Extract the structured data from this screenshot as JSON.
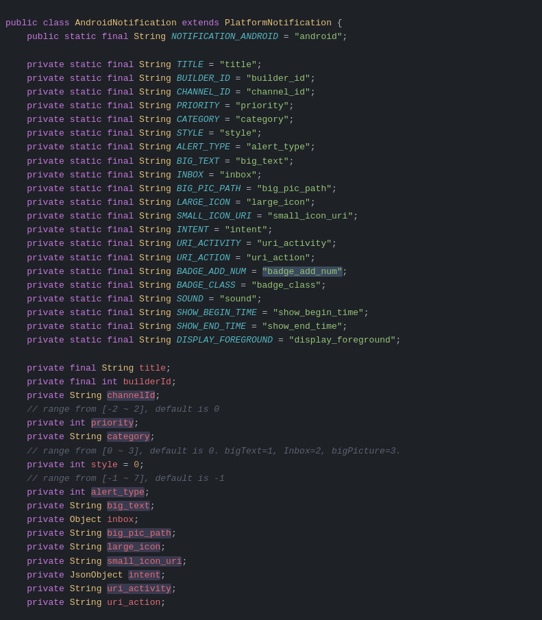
{
  "code": {
    "lines": [
      {
        "id": 1,
        "html": "<span class='kw'>public</span> <span class='kw'>class</span> <span class='cls'>AndroidNotification</span> <span class='kw'>extends</span> <span class='cls'>PlatformNotification</span> <span class='plain'>{</span>"
      },
      {
        "id": 2,
        "html": "    <span class='kw'>public</span> <span class='kw'>static</span> <span class='kw'>final</span> <span class='type'>String</span> <span class='const'>NOTIFICATION_ANDROID</span> <span class='plain'>= </span><span class='str'>\"android\"</span><span class='plain'>;</span>"
      },
      {
        "id": 3,
        "html": ""
      },
      {
        "id": 4,
        "html": "    <span class='kw'>private</span> <span class='kw'>static</span> <span class='kw'>final</span> <span class='type'>String</span> <span class='const'>TITLE</span> <span class='plain'>= </span><span class='str'>\"title\"</span><span class='plain'>;</span>"
      },
      {
        "id": 5,
        "html": "    <span class='kw'>private</span> <span class='kw'>static</span> <span class='kw'>final</span> <span class='type'>String</span> <span class='const'>BUILDER_ID</span> <span class='plain'>= </span><span class='str'>\"builder_id\"</span><span class='plain'>;</span>"
      },
      {
        "id": 6,
        "html": "    <span class='kw'>private</span> <span class='kw'>static</span> <span class='kw'>final</span> <span class='type'>String</span> <span class='const'>CHANNEL_ID</span> <span class='plain'>= </span><span class='str'>\"channel_id\"</span><span class='plain'>;</span>"
      },
      {
        "id": 7,
        "html": "    <span class='kw'>private</span> <span class='kw'>static</span> <span class='kw'>final</span> <span class='type'>String</span> <span class='const'>PRIORITY</span> <span class='plain'>= </span><span class='str'>\"priority\"</span><span class='plain'>;</span>"
      },
      {
        "id": 8,
        "html": "    <span class='kw'>private</span> <span class='kw'>static</span> <span class='kw'>final</span> <span class='type'>String</span> <span class='const'>CATEGORY</span> <span class='plain'>= </span><span class='str'>\"category\"</span><span class='plain'>;</span>"
      },
      {
        "id": 9,
        "html": "    <span class='kw'>private</span> <span class='kw'>static</span> <span class='kw'>final</span> <span class='type'>String</span> <span class='const'>STYLE</span> <span class='plain'>= </span><span class='str'>\"style\"</span><span class='plain'>;</span>"
      },
      {
        "id": 10,
        "html": "    <span class='kw'>private</span> <span class='kw'>static</span> <span class='kw'>final</span> <span class='type'>String</span> <span class='const'>ALERT_TYPE</span> <span class='plain'>= </span><span class='str'>\"alert_type\"</span><span class='plain'>;</span>"
      },
      {
        "id": 11,
        "html": "    <span class='kw'>private</span> <span class='kw'>static</span> <span class='kw'>final</span> <span class='type'>String</span> <span class='const'>BIG_TEXT</span> <span class='plain'>= </span><span class='str'>\"big_text\"</span><span class='plain'>;</span>"
      },
      {
        "id": 12,
        "html": "    <span class='kw'>private</span> <span class='kw'>static</span> <span class='kw'>final</span> <span class='type'>String</span> <span class='const'>INBOX</span> <span class='plain'>= </span><span class='str'>\"inbox\"</span><span class='plain'>;</span>"
      },
      {
        "id": 13,
        "html": "    <span class='kw'>private</span> <span class='kw'>static</span> <span class='kw'>final</span> <span class='type'>String</span> <span class='const'>BIG_PIC_PATH</span> <span class='plain'>= </span><span class='str'>\"big_pic_path\"</span><span class='plain'>;</span>"
      },
      {
        "id": 14,
        "html": "    <span class='kw'>private</span> <span class='kw'>static</span> <span class='kw'>final</span> <span class='type'>String</span> <span class='const'>LARGE_ICON</span> <span class='plain'>= </span><span class='str'>\"large_icon\"</span><span class='plain'>;</span>"
      },
      {
        "id": 15,
        "html": "    <span class='kw'>private</span> <span class='kw'>static</span> <span class='kw'>final</span> <span class='type'>String</span> <span class='const'>SMALL_ICON_URI</span> <span class='plain'>= </span><span class='str'>\"small_icon_uri\"</span><span class='plain'>;</span>"
      },
      {
        "id": 16,
        "html": "    <span class='kw'>private</span> <span class='kw'>static</span> <span class='kw'>final</span> <span class='type'>String</span> <span class='const'>INTENT</span> <span class='plain'>= </span><span class='str'>\"intent\"</span><span class='plain'>;</span>"
      },
      {
        "id": 17,
        "html": "    <span class='kw'>private</span> <span class='kw'>static</span> <span class='kw'>final</span> <span class='type'>String</span> <span class='const'>URI_ACTIVITY</span> <span class='plain'>= </span><span class='str'>\"uri_activity\"</span><span class='plain'>;</span>"
      },
      {
        "id": 18,
        "html": "    <span class='kw'>private</span> <span class='kw'>static</span> <span class='kw'>final</span> <span class='type'>String</span> <span class='const'>URI_ACTION</span> <span class='plain'>= </span><span class='str'>\"uri_action\"</span><span class='plain'>;</span>"
      },
      {
        "id": 19,
        "html": "    <span class='kw'>private</span> <span class='kw'>static</span> <span class='kw'>final</span> <span class='type'>String</span> <span class='const'>BADGE_ADD_NUM</span> <span class='plain'>= </span><span class='str'><span class='highlight-sel'>\"badge_add_num\"</span></span><span class='plain'>;</span>"
      },
      {
        "id": 20,
        "html": "    <span class='kw'>private</span> <span class='kw'>static</span> <span class='kw'>final</span> <span class='type'>String</span> <span class='const'>BADGE_CLASS</span> <span class='plain'>= </span><span class='str'>\"badge_class\"</span><span class='plain'>;</span>"
      },
      {
        "id": 21,
        "html": "    <span class='kw'>private</span> <span class='kw'>static</span> <span class='kw'>final</span> <span class='type'>String</span> <span class='const'>SOUND</span> <span class='plain'>= </span><span class='str'>\"sound\"</span><span class='plain'>;</span>"
      },
      {
        "id": 22,
        "html": "    <span class='kw'>private</span> <span class='kw'>static</span> <span class='kw'>final</span> <span class='type'>String</span> <span class='const'>SHOW_BEGIN_TIME</span> <span class='plain'>= </span><span class='str'>\"show_begin_time\"</span><span class='plain'>;</span>"
      },
      {
        "id": 23,
        "html": "    <span class='kw'>private</span> <span class='kw'>static</span> <span class='kw'>final</span> <span class='type'>String</span> <span class='const'>SHOW_END_TIME</span> <span class='plain'>= </span><span class='str'>\"show_end_time\"</span><span class='plain'>;</span>"
      },
      {
        "id": 24,
        "html": "    <span class='kw'>private</span> <span class='kw'>static</span> <span class='kw'>final</span> <span class='type'>String</span> <span class='const'>DISPLAY_FOREGROUND</span> <span class='plain'>= </span><span class='str'>\"display_foreground\"</span><span class='plain'>;</span>"
      },
      {
        "id": 25,
        "html": ""
      },
      {
        "id": 26,
        "html": "    <span class='kw'>private</span> <span class='kw'>final</span> <span class='type'>String</span> <span class='var'>title</span><span class='plain'>;</span>"
      },
      {
        "id": 27,
        "html": "    <span class='kw'>private</span> <span class='kw'>final</span> <span class='kw'>int</span> <span class='var'>builderId</span><span class='plain'>;</span>"
      },
      {
        "id": 28,
        "html": "    <span class='kw'>private</span> <span class='type'>String</span> <span class='var'><span class='highlight-field'>channelId</span></span><span class='plain'>;</span>"
      },
      {
        "id": 29,
        "html": "    <span class='comment'>// range from [-2 ~ 2], default is 0</span>"
      },
      {
        "id": 30,
        "html": "    <span class='kw'>private</span> <span class='kw'>int</span> <span class='var'><span class='highlight-field'>priority</span></span><span class='plain'>;</span>"
      },
      {
        "id": 31,
        "html": "    <span class='kw'>private</span> <span class='type'>String</span> <span class='var'><span class='highlight-field'>category</span></span><span class='plain'>;</span>"
      },
      {
        "id": 32,
        "html": "    <span class='comment'>// range from [0 ~ 3], default is 0. bigText=1, Inbox=2, bigPicture=3.</span>"
      },
      {
        "id": 33,
        "html": "    <span class='kw'>private</span> <span class='kw'>int</span> <span class='var'>style</span> <span class='plain'>= </span><span class='num'>0</span><span class='plain'>;</span>"
      },
      {
        "id": 34,
        "html": "    <span class='comment'>// range from [-1 ~ 7], default is -1</span>"
      },
      {
        "id": 35,
        "html": "    <span class='kw'>private</span> <span class='kw'>int</span> <span class='var'><span class='highlight-field'>alert_type</span></span><span class='plain'>;</span>"
      },
      {
        "id": 36,
        "html": "    <span class='kw'>private</span> <span class='type'>String</span> <span class='var'><span class='highlight-field'>big_text</span></span><span class='plain'>;</span>"
      },
      {
        "id": 37,
        "html": "    <span class='kw'>private</span> <span class='type'>Object</span> <span class='var'>inbox</span><span class='plain'>;</span>"
      },
      {
        "id": 38,
        "html": "    <span class='kw'>private</span> <span class='type'>String</span> <span class='var'><span class='highlight-field'>big_pic_path</span></span><span class='plain'>;</span>"
      },
      {
        "id": 39,
        "html": "    <span class='kw'>private</span> <span class='type'>String</span> <span class='var'><span class='highlight-field'>large_icon</span></span><span class='plain'>;</span>"
      },
      {
        "id": 40,
        "html": "    <span class='kw'>private</span> <span class='type'>String</span> <span class='var'><span class='highlight-field'>small_icon_uri</span></span><span class='plain'>;</span>"
      },
      {
        "id": 41,
        "html": "    <span class='kw'>private</span> <span class='type'>JsonObject</span> <span class='var'><span class='highlight-field'>intent</span></span><span class='plain'>;</span>"
      },
      {
        "id": 42,
        "html": "    <span class='kw'>private</span> <span class='type'>String</span> <span class='var'><span class='highlight-field'>uri_activity</span></span><span class='plain'>;</span>"
      },
      {
        "id": 43,
        "html": "    <span class='kw'>private</span> <span class='type'>String</span> <span class='var'>uri_action</span><span class='plain'>;</span>"
      }
    ]
  }
}
